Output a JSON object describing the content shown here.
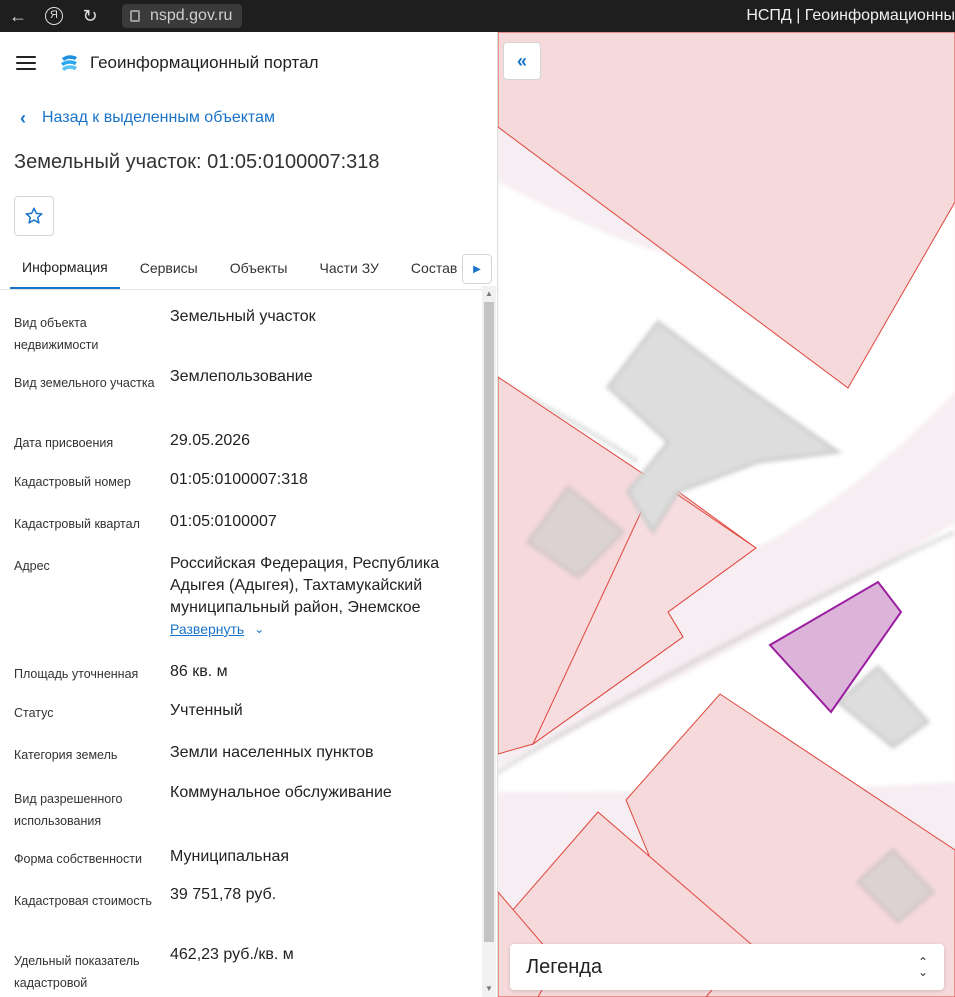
{
  "browser": {
    "url": "nspd.gov.ru",
    "tab_title": "НСПД | Геоинформационны",
    "yandex_glyph": "Я"
  },
  "header": {
    "portal_title": "Геоинформационный портал"
  },
  "back_link": "Назад к выделенным объектам",
  "object_title": "Земельный участок: 01:05:0100007:318",
  "tabs": [
    {
      "label": "Информация",
      "active": true
    },
    {
      "label": "Сервисы",
      "active": false
    },
    {
      "label": "Объекты",
      "active": false
    },
    {
      "label": "Части ЗУ",
      "active": false
    },
    {
      "label": "Состав",
      "active": false
    }
  ],
  "fields": [
    {
      "label": "Вид объекта недвижимости",
      "value": "Земельный участок"
    },
    {
      "label": "Вид земельного участка",
      "value": "Землепользование"
    },
    {
      "label": "Дата присвоения",
      "value": "29.05.2026"
    },
    {
      "label": "Кадастровый номер",
      "value": "01:05:0100007:318"
    },
    {
      "label": "Кадастровый квартал",
      "value": "01:05:0100007"
    },
    {
      "label": "Адрес",
      "value": "Российская Федерация, Республика Адыгея (Адыгея), Тахтамукайский муниципальный район, Энемское",
      "expand": "Развернуть"
    },
    {
      "label": "Площадь уточненная",
      "value": "86 кв. м"
    },
    {
      "label": "Статус",
      "value": "Учтенный"
    },
    {
      "label": "Категория земель",
      "value": "Земли населенных пунктов"
    },
    {
      "label": "Вид разрешенного использования",
      "value": "Коммунальное обслуживание"
    },
    {
      "label": "Форма собственности",
      "value": "Муниципальная"
    },
    {
      "label": "Кадастровая стоимость",
      "value": "39 751,78 руб."
    },
    {
      "label": "Удельный показатель кадастровой",
      "value": "462,23 руб./кв. м"
    }
  ],
  "map": {
    "legend_title": "Легенда",
    "parcel_color": "#c24fc0",
    "boundary_color": "#e0463c"
  },
  "colors": {
    "accent": "#1a73c9"
  }
}
